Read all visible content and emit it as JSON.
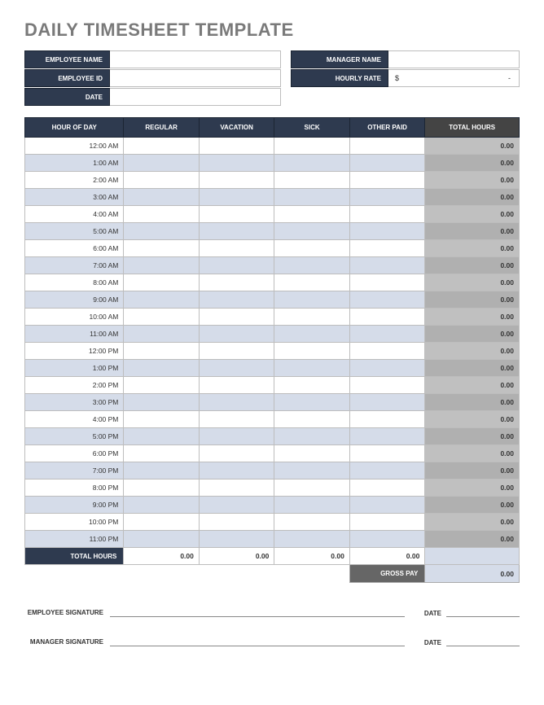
{
  "title": "DAILY TIMESHEET TEMPLATE",
  "header": {
    "employee_name_label": "EMPLOYEE NAME",
    "employee_name": "",
    "manager_name_label": "MANAGER NAME",
    "manager_name": "",
    "employee_id_label": "EMPLOYEE ID",
    "employee_id": "",
    "hourly_rate_label": "HOURLY RATE",
    "hourly_rate_currency": "$",
    "hourly_rate_value": "-",
    "date_label": "DATE",
    "date": ""
  },
  "columns": {
    "hour": "HOUR OF DAY",
    "regular": "REGULAR",
    "vacation": "VACATION",
    "sick": "SICK",
    "other": "OTHER PAID",
    "total": "TOTAL HOURS"
  },
  "rows": [
    {
      "hour": "12:00 AM",
      "regular": "",
      "vacation": "",
      "sick": "",
      "other": "",
      "total": "0.00"
    },
    {
      "hour": "1:00 AM",
      "regular": "",
      "vacation": "",
      "sick": "",
      "other": "",
      "total": "0.00"
    },
    {
      "hour": "2:00 AM",
      "regular": "",
      "vacation": "",
      "sick": "",
      "other": "",
      "total": "0.00"
    },
    {
      "hour": "3:00 AM",
      "regular": "",
      "vacation": "",
      "sick": "",
      "other": "",
      "total": "0.00"
    },
    {
      "hour": "4:00 AM",
      "regular": "",
      "vacation": "",
      "sick": "",
      "other": "",
      "total": "0.00"
    },
    {
      "hour": "5:00 AM",
      "regular": "",
      "vacation": "",
      "sick": "",
      "other": "",
      "total": "0.00"
    },
    {
      "hour": "6:00 AM",
      "regular": "",
      "vacation": "",
      "sick": "",
      "other": "",
      "total": "0.00"
    },
    {
      "hour": "7:00 AM",
      "regular": "",
      "vacation": "",
      "sick": "",
      "other": "",
      "total": "0.00"
    },
    {
      "hour": "8:00 AM",
      "regular": "",
      "vacation": "",
      "sick": "",
      "other": "",
      "total": "0.00"
    },
    {
      "hour": "9:00 AM",
      "regular": "",
      "vacation": "",
      "sick": "",
      "other": "",
      "total": "0.00"
    },
    {
      "hour": "10:00 AM",
      "regular": "",
      "vacation": "",
      "sick": "",
      "other": "",
      "total": "0.00"
    },
    {
      "hour": "11:00 AM",
      "regular": "",
      "vacation": "",
      "sick": "",
      "other": "",
      "total": "0.00"
    },
    {
      "hour": "12:00 PM",
      "regular": "",
      "vacation": "",
      "sick": "",
      "other": "",
      "total": "0.00"
    },
    {
      "hour": "1:00 PM",
      "regular": "",
      "vacation": "",
      "sick": "",
      "other": "",
      "total": "0.00"
    },
    {
      "hour": "2:00 PM",
      "regular": "",
      "vacation": "",
      "sick": "",
      "other": "",
      "total": "0.00"
    },
    {
      "hour": "3:00 PM",
      "regular": "",
      "vacation": "",
      "sick": "",
      "other": "",
      "total": "0.00"
    },
    {
      "hour": "4:00 PM",
      "regular": "",
      "vacation": "",
      "sick": "",
      "other": "",
      "total": "0.00"
    },
    {
      "hour": "5:00 PM",
      "regular": "",
      "vacation": "",
      "sick": "",
      "other": "",
      "total": "0.00"
    },
    {
      "hour": "6:00 PM",
      "regular": "",
      "vacation": "",
      "sick": "",
      "other": "",
      "total": "0.00"
    },
    {
      "hour": "7:00 PM",
      "regular": "",
      "vacation": "",
      "sick": "",
      "other": "",
      "total": "0.00"
    },
    {
      "hour": "8:00 PM",
      "regular": "",
      "vacation": "",
      "sick": "",
      "other": "",
      "total": "0.00"
    },
    {
      "hour": "9:00 PM",
      "regular": "",
      "vacation": "",
      "sick": "",
      "other": "",
      "total": "0.00"
    },
    {
      "hour": "10:00 PM",
      "regular": "",
      "vacation": "",
      "sick": "",
      "other": "",
      "total": "0.00"
    },
    {
      "hour": "11:00 PM",
      "regular": "",
      "vacation": "",
      "sick": "",
      "other": "",
      "total": "0.00"
    }
  ],
  "totals": {
    "label": "TOTAL HOURS",
    "regular": "0.00",
    "vacation": "0.00",
    "sick": "0.00",
    "other": "0.00",
    "total": ""
  },
  "gross_pay": {
    "label": "GROSS PAY",
    "value": "0.00"
  },
  "signatures": {
    "employee_label": "EMPLOYEE SIGNATURE",
    "manager_label": "MANAGER SIGNATURE",
    "date_label": "DATE"
  }
}
